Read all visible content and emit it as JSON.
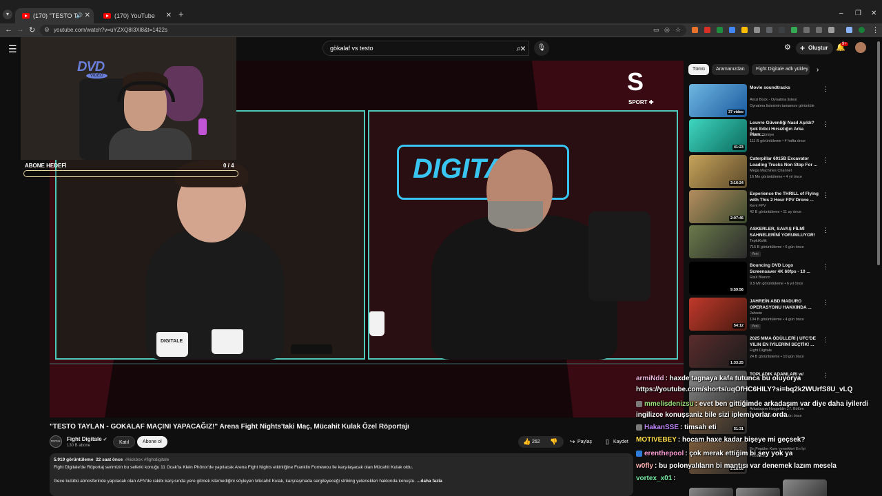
{
  "browser": {
    "tabs": [
      {
        "title": "(170) \"TESTO TAYLAN - GOKAL",
        "active": true
      },
      {
        "title": "(170) YouTube",
        "active": false
      }
    ],
    "url": "youtube.com/watch?v=uYZXQ8I3Xl8&t=1422s",
    "new_tab": "+",
    "minimize": "–",
    "restore": "❐",
    "close": "✕"
  },
  "youtube": {
    "search_query": "gökalaf vs testo",
    "create_label": "Oluştur",
    "notifications": "9+"
  },
  "player": {
    "sport_logo_text": "SPORT",
    "bg_logo_text": "DIGITALE",
    "mug_label": "DIGITALE"
  },
  "overlay": {
    "dvd_text": "DVD",
    "dvd_sub": "VIDEO",
    "goal_label": "ABONE HEDEFİ",
    "goal_count": "0 / 4",
    "goal_progress": 0
  },
  "video": {
    "title": "\"TESTO TAYLAN - GOKALAF MAÇINI YAPACAĞIZ!\" Arena Fight Nights'taki Maç, Mücahit Kulak Özel Röportajı",
    "channel": "Fight Digitale",
    "subs": "130 B abone",
    "join": "Katıl",
    "subscribe": "Abone ol",
    "likes": "262",
    "share": "Paylaş",
    "save": "Kaydet",
    "views": "5.919 görüntüleme",
    "time_ago": "22 saat önce",
    "tags": "#kickbox #fightdigitale",
    "desc_line1": "Fight Digitale'de Röportaj serimizin bu seferki konuğu  11 Ocak'ta Klein Phönix'de yapılacak Arena Fight Nights etkinliğine Franklin Fomewou ile karşılaşacak olan Mücahit Kulak oldu.",
    "desc_line2": "Gece kulübü atmosferinde yapılacak olan AFN'de rakibi karşısında yere gitmek istemediğini söyleyen Mücahit Kulak, karşılaşmada sergileyeceği striking yetenekleri hakkında konuştu.",
    "more": "...daha fazla"
  },
  "chips": [
    "Tümü",
    "Aramanızdan",
    "Fight Digitale adlı yükley"
  ],
  "recommendations": [
    {
      "title": "Movie soundtracks",
      "channel": "Amzi Bock - Oynatma listesi",
      "meta": "Oynatma listesinin tamamını görüntüle",
      "duration": "37 video",
      "badge": ""
    },
    {
      "title": "Louvre Güvenliği Nasıl Aşıldı? Şok Edici Hırsızlığın Arka Planı...",
      "channel": "DMAX Türkiye",
      "meta": "111 B görüntüleme • 4 hafta önce",
      "duration": "41:23",
      "badge": ""
    },
    {
      "title": "Caterpillar 6015B Excavator Loading Trucks Non Stop For ...",
      "channel": "Mega Machines Channel",
      "meta": "16 Mn görüntüleme • 4 yıl önce",
      "duration": "3:16:24",
      "badge": ""
    },
    {
      "title": "Experience the THRILL of Flying with This 2 Hour FPV Drone ...",
      "channel": "Kent FPV",
      "meta": "42 B görüntüleme • 11 ay önce",
      "duration": "2:07:46",
      "badge": ""
    },
    {
      "title": "ASKERLER, SAVAŞ FİLMİ SAHNELERİNİ YORUMLUYOR!",
      "channel": "TepkiKolik",
      "meta": "715 B görüntüleme • 6 gün önce",
      "duration": "",
      "badge": "Yeni"
    },
    {
      "title": "Bouncing DVD Logo Screensaver 4K 60fps - 10 ...",
      "channel": "Raül Blanco",
      "meta": "9,9 Mn görüntüleme • 6 yıl önce",
      "duration": "9:59:56",
      "badge": ""
    },
    {
      "title": "JAHREİN ABD MADURO OPERASYONU HAKKINDA ...",
      "channel": "Jahrein",
      "meta": "104 B görüntüleme • 4 gün önce",
      "duration": "54:12",
      "badge": "Yeni"
    },
    {
      "title": "2025 MMA ÖDÜLLERİ | UFC'DE YILIN EN İYİLERİNİ SEÇTİK! ...",
      "channel": "Fight Digitale",
      "meta": "24 B görüntüleme • 10 gün önce",
      "duration": "1:33:25",
      "badge": ""
    },
    {
      "title": "TOPLADIK ADAMLARI w/",
      "channel": "",
      "meta": "",
      "duration": "",
      "badge": ""
    }
  ],
  "partial_recs": [
    {
      "channel": "Arkadaşım Hoşgeldin 27. Bölüm",
      "meta": "16 B görüntüleme • 1 gün önce",
      "duration": "51:31"
    },
    {
      "channel": "En Popüler Kore yemekleri En İyi",
      "meta": "Foodieboy",
      "duration": "2:18:06"
    }
  ],
  "chat": [
    {
      "user": "armiNdd",
      "text": ": haxde tagnaya kafa tutunca bu oluyorya",
      "color": "#f5b8e0",
      "badge": ""
    },
    {
      "user": "",
      "text": "https://youtube.com/shorts/uqOfHC6HILY?si=bq2k2WUrfS8U_vLQ",
      "color": "#ffffff",
      "badge": ""
    },
    {
      "user": "mmelisdenizsu",
      "text": ": evet ben gittiğimde arkadaşım var diye daha iyilerdi",
      "color": "#9be07c",
      "badge": "#7a7a7a"
    },
    {
      "user": "",
      "text": "ingilizce konuşsaniz bile sizi iplemiyorlar orda",
      "color": "#ffffff",
      "badge": ""
    },
    {
      "user": "HakanSSE",
      "text": ": timsah eti",
      "color": "#c389ff",
      "badge": "#7a7a7a"
    },
    {
      "user": "MOTIVEBEY",
      "text": ": hocam haxe kadar bişeye mi geçsek?",
      "color": "#ffe14d",
      "badge": ""
    },
    {
      "user": "erenthepool",
      "text": ": çok merak ettiğim bi şey yok ya",
      "color": "#ff9fd6",
      "badge": "#2f7bd8"
    },
    {
      "user": "w0fly",
      "text": ": bu polonyalıların bi mantısı var denemek lazım mesela",
      "color": "#ffb3b3",
      "badge": ""
    },
    {
      "user": "vortex_x01",
      "text": ":",
      "color": "#7cf0a8",
      "badge": ""
    }
  ]
}
